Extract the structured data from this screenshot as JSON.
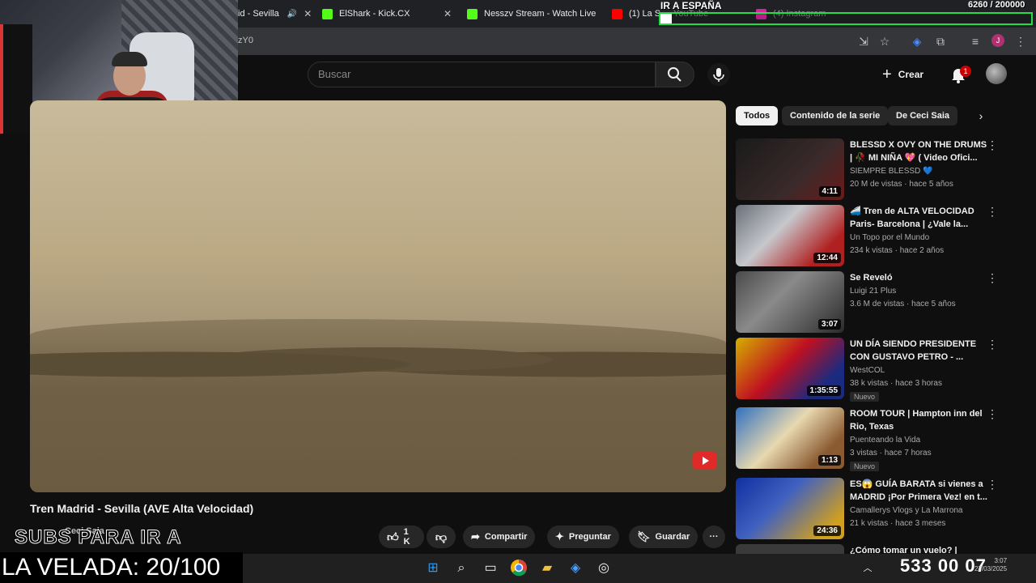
{
  "browser": {
    "tabs": [
      {
        "label": "id - Sevilla",
        "icon": "speaker-icon"
      },
      {
        "label": "ElShark - Kick.CX"
      },
      {
        "label": "Nesszv Stream - Watch Live"
      },
      {
        "label": "(1) La Sa..."
      },
      {
        "label": "YouTube"
      },
      {
        "label": "(4) Instagram"
      }
    ],
    "url": "zY0"
  },
  "youtube": {
    "search_placeholder": "Buscar",
    "create_label": "Crear",
    "notif_count": "1"
  },
  "video": {
    "title": "Tren Madrid - Sevilla (AVE Alta Velocidad)",
    "channel": "Ceci Saia",
    "likes": "1 K",
    "share_label": "Compartir",
    "ask_label": "Preguntar",
    "save_label": "Guardar"
  },
  "chips": [
    "Todos",
    "Contenido de la serie",
    "De Ceci Saia"
  ],
  "recommendations": [
    {
      "title": "BLESSD X OVY ON THE DRUMS | 🥀 MI NIÑA 💖 ( Video Ofici...",
      "channel": "SIEMPRE BLESSD 💙",
      "meta": "20 M de vistas · hace 5 años",
      "duration": "4:11",
      "badge": ""
    },
    {
      "title": "🚄 Tren de ALTA VELOCIDAD Paris- Barcelona | ¿Vale la...",
      "channel": "Un Topo por el Mundo",
      "meta": "234 k vistas · hace 2 años",
      "duration": "12:44",
      "badge": ""
    },
    {
      "title": "Se Reveló",
      "channel": "Luigi 21 Plus",
      "meta": "3.6 M de vistas · hace 5 años",
      "duration": "3:07",
      "badge": ""
    },
    {
      "title": "UN DÍA SIENDO PRESIDENTE CON GUSTAVO PETRO - ...",
      "channel": "WestCOL",
      "meta": "38 k vistas · hace 3 horas",
      "duration": "1:35:55",
      "badge": "Nuevo"
    },
    {
      "title": "ROOM TOUR | Hampton inn del Rio, Texas",
      "channel": "Puenteando la Vida",
      "meta": "3 vistas · hace 7 horas",
      "duration": "1:13",
      "badge": "Nuevo"
    },
    {
      "title": "ES😱 GUÍA BARATA si vienes a MADRID ¡Por Primera Vez! en t...",
      "channel": "Camallerys Vlogs y La Marrona",
      "meta": "21 k vistas · hace 3 meses",
      "duration": "24:36",
      "badge": ""
    },
    {
      "title": "¿Cómo tomar un vuelo? |",
      "channel": "",
      "meta": "",
      "duration": "",
      "badge": ""
    }
  ],
  "overlay": {
    "top_text": "IR A ESPAÑA",
    "counter": "6260 / 200000",
    "progress": 0.0313,
    "subs_text": "SUBS PARA IR A",
    "velada_text": "LA VELADA: 20/100"
  },
  "taskbar": {
    "clock": "533 00 07",
    "time": "3:07",
    "date": "27/03/2025"
  },
  "colors": {
    "accent": "#cc0000",
    "progress_border": "#22dd44"
  }
}
